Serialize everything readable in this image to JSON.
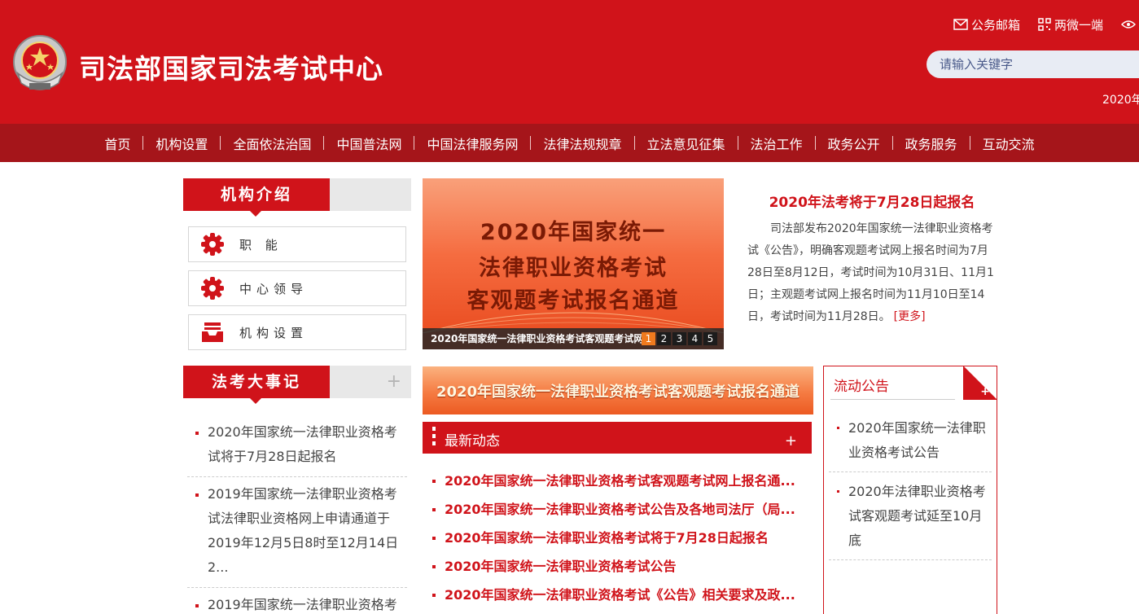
{
  "header": {
    "site_title": "司法部国家司法考试中心",
    "top_links": [
      {
        "label": "公务邮箱",
        "icon": "mail-icon"
      },
      {
        "label": "两微一端",
        "icon": "qrcode-icon"
      },
      {
        "label": "",
        "icon": "eye-icon"
      }
    ],
    "search_placeholder": "请输入关键字",
    "date_text": "2020年"
  },
  "nav": {
    "items": [
      "首页",
      "机构设置",
      "全面依法治国",
      "中国普法网",
      "中国法律服务网",
      "法律法规规章",
      "立法意见征集",
      "法治工作",
      "政务公开",
      "政务服务",
      "互动交流"
    ]
  },
  "intro": {
    "title": "机构介绍",
    "items": [
      {
        "label": "职 能",
        "icon": "gear-icon"
      },
      {
        "label": "中心领导",
        "icon": "gear-icon"
      },
      {
        "label": "机构设置",
        "icon": "inbox-icon"
      }
    ]
  },
  "events": {
    "title": "法考大事记",
    "plus": "+",
    "items": [
      "2020年国家统一法律职业资格考试将于7月28日起报名",
      "2019年国家统一法律职业资格考试法律职业资格网上申请通道于2019年12月5日8时至12月14日2...",
      "2019年国家统一法律职业资格考"
    ]
  },
  "carousel": {
    "lines": [
      "2020年国家统一",
      "法律职业资格考试",
      "客观题考试报名通道"
    ],
    "caption": "2020年国家统一法律职业资格考试客观题考试网",
    "dots": [
      "1",
      "2",
      "3",
      "4",
      "5"
    ],
    "active_dot": 0
  },
  "headline": {
    "title": "2020年法考将于7月28日起报名",
    "body": "司法部发布2020年国家统一法律职业资格考试《公告》，明确客观题考试网上报名时间为7月28日至8月12日，考试时间为10月31日、11月1日；主观题考试网上报名时间为11月10日至14日，考试时间为11月28日。",
    "more": "[更多]"
  },
  "banner": {
    "text": "2020年国家统一法律职业资格考试客观题考试报名通道"
  },
  "news": {
    "title": "最新动态",
    "plus": "+",
    "items": [
      "2020年国家统一法律职业资格考试客观题考试网上报名通...",
      "2020年国家统一法律职业资格考试公告及各地司法厅（局...",
      "2020年国家统一法律职业资格考试将于7月28日起报名",
      "2020年国家统一法律职业资格考试公告",
      "2020年国家统一法律职业资格考试《公告》相关要求及政..."
    ]
  },
  "notice": {
    "title": "流动公告",
    "plus": "+",
    "items": [
      "2020年国家统一法律职业资格考试公告",
      "2020年法律职业资格考试客观题考试延至10月底"
    ]
  },
  "colors": {
    "brand_red": "#d0131a",
    "nav_dark_red": "#a5151a",
    "accent_orange": "#f07a1e"
  }
}
